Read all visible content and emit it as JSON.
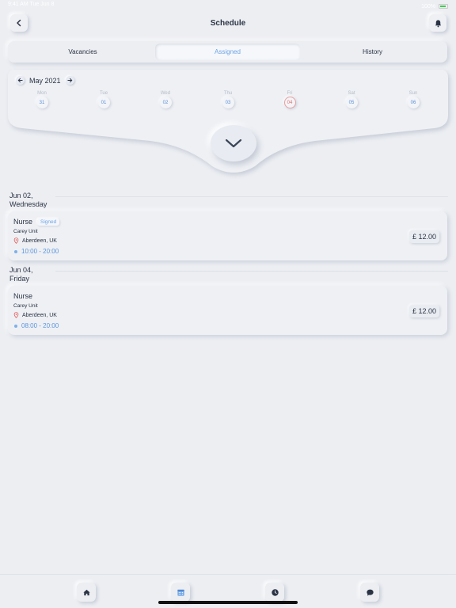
{
  "status_bar": {
    "time": "9:41 AM  Tue Jun 8",
    "battery": "100%"
  },
  "header": {
    "title": "Schedule"
  },
  "tabs": [
    {
      "label": "Vacancies",
      "active": false
    },
    {
      "label": "Assigned",
      "active": true
    },
    {
      "label": "History",
      "active": false
    }
  ],
  "calendar": {
    "month": "May 2021",
    "days": [
      {
        "name": "Mon",
        "num": "31"
      },
      {
        "name": "Tue",
        "num": "01"
      },
      {
        "name": "Wed",
        "num": "02"
      },
      {
        "name": "Thu",
        "num": "03"
      },
      {
        "name": "Fri",
        "num": "04",
        "today": true
      },
      {
        "name": "Sat",
        "num": "05"
      },
      {
        "name": "Sun",
        "num": "06"
      }
    ]
  },
  "shifts": [
    {
      "date_line1": "Jun 02,",
      "date_line2": "Wednesday",
      "role": "Nurse",
      "badge": "Signed",
      "unit": "Carey Unit",
      "location": "Aberdeen, UK",
      "time": "10:00 - 20:00",
      "price": "£ 12.00"
    },
    {
      "date_line1": "Jun 04,",
      "date_line2": "Friday",
      "role": "Nurse",
      "badge": "",
      "unit": "Carey Unit",
      "location": "Aberdeen, UK",
      "time": "08:00 - 20:00",
      "price": "£ 12.00"
    }
  ],
  "bottom_nav": {
    "items": [
      {
        "icon": "home-icon",
        "active": false
      },
      {
        "icon": "calendar-icon",
        "active": true
      },
      {
        "icon": "clock-icon",
        "active": false
      },
      {
        "icon": "chat-icon",
        "active": false
      }
    ]
  },
  "colors": {
    "accent": "#6fa5e6",
    "today": "#e07070",
    "background": "#eceef2",
    "text": "#2b3445"
  }
}
